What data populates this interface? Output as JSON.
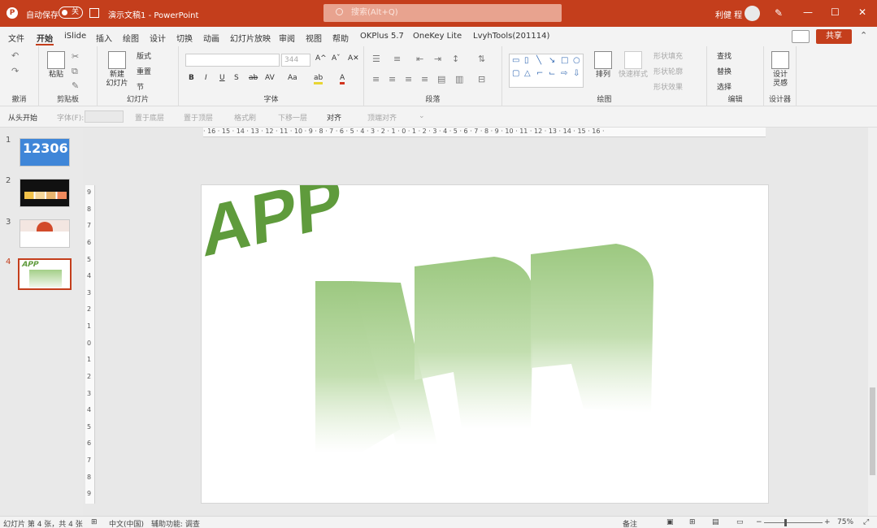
{
  "titlebar": {
    "autosave_label": "自动保存",
    "autosave_state": "关",
    "document_title": "演示文稿1",
    "app_separator": "-",
    "app_name": "PowerPoint",
    "search_placeholder": "搜索(Alt+Q)",
    "user_name": "利健 程",
    "logo_letter": "P",
    "pen_glyph": "✎",
    "minimize_glyph": "—",
    "maximize_glyph": "☐",
    "close_glyph": "✕"
  },
  "menu": {
    "tabs": [
      "文件",
      "开始",
      "iSlide",
      "插入",
      "绘图",
      "设计",
      "切换",
      "动画",
      "幻灯片放映",
      "审阅",
      "视图",
      "帮助",
      "OKPlus 5.7",
      "OneKey Lite",
      "LvyhTools(201114)"
    ],
    "active_tab": "开始",
    "share_label": "共享",
    "ribbon_toggle_glyph": "⌃"
  },
  "ribbon": {
    "groups": {
      "undo": "撤消",
      "clipboard": "剪贴板",
      "slides": "幻灯片",
      "font": "字体",
      "paragraph": "段落",
      "drawing": "绘图",
      "editing": "编辑",
      "designer": "设计器"
    },
    "paste_label": "粘贴",
    "new_slide_label_1": "新建",
    "new_slide_label_2": "幻灯片",
    "layout_label": "版式",
    "reset_label": "重置",
    "section_label": "节",
    "font_size": "344",
    "font_buttons": [
      "B",
      "I",
      "U",
      "S",
      "ab",
      "AV",
      "Aa",
      "A"
    ],
    "grow_font": "A^",
    "shrink_font": "Aˇ",
    "clear_format": "A✕",
    "arrange_label": "排列",
    "quick_styles_label": "快速样式",
    "shape_fill_label": "形状填充",
    "shape_outline_label": "形状轮廓",
    "shape_effects_label": "形状效果",
    "find_label": "查找",
    "replace_label": "替换",
    "select_label": "选择",
    "design_ideas_1": "设计",
    "design_ideas_2": "灵感"
  },
  "qat": {
    "from_start": "从头开始",
    "font_label": "字体(F):",
    "items": [
      "置于底层",
      "置于顶层",
      "格式刷",
      "下移一层",
      "对齐",
      "顶端对齐"
    ],
    "more_glyph": "⌄"
  },
  "slides": {
    "numbers": [
      "1",
      "2",
      "3",
      "4"
    ],
    "active_index": 4,
    "thumb1_text": "12306"
  },
  "slide": {
    "word_top": "APP",
    "word_extruded": "APP",
    "top_color": "#5f9b3c",
    "extrude_color": "#9cc880"
  },
  "rulers": {
    "horizontal": "· 16 · 15 · 14 · 13 · 12 · 11 · 10 · 9 · 8 · 7 · 6 · 5 · 4 · 3 · 2 · 1 · 0 · 1 · 2 · 3 · 4 · 5 · 6 · 7 · 8 · 9 · 10 · 11 · 12 · 13 · 14 · 15 · 16 ·",
    "vertical": [
      "9",
      "8",
      "7",
      "6",
      "5",
      "4",
      "3",
      "2",
      "1",
      "0",
      "1",
      "2",
      "3",
      "4",
      "5",
      "6",
      "7",
      "8",
      "9"
    ]
  },
  "status": {
    "slide_info": "幻灯片 第 4 张，共 4 张",
    "language": "中文(中国)",
    "accessibility": "辅助功能: 调查",
    "notes": "备注",
    "zoom": "75%",
    "zoom_minus": "−",
    "zoom_plus": "+"
  }
}
